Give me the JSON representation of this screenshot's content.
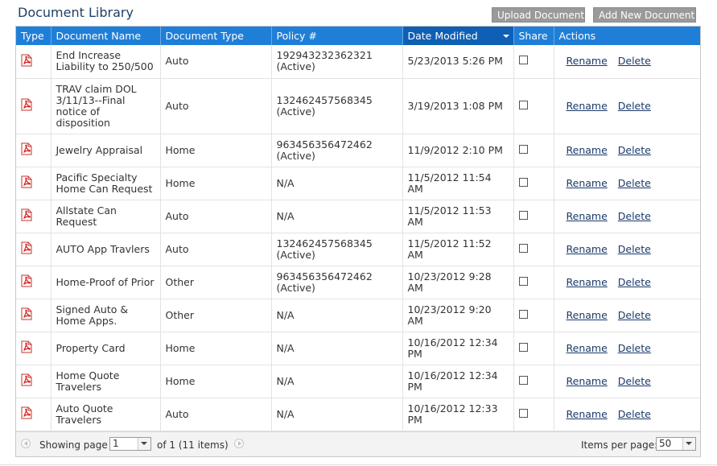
{
  "page_title": "Document Library",
  "buttons": {
    "upload": "Upload Document",
    "add_new": "Add New Document"
  },
  "columns": {
    "type": "Type",
    "name": "Document Name",
    "doctype": "Document Type",
    "policy": "Policy #",
    "date": "Date Modified",
    "share": "Share",
    "actions": "Actions"
  },
  "actions": {
    "rename": "Rename",
    "delete": "Delete"
  },
  "rows": [
    {
      "name": "End Increase Liability to 250/500",
      "doctype": "Auto",
      "policy": "192943232362321 (Active)",
      "date": "5/23/2013 5:26 PM",
      "shared": false
    },
    {
      "name": "TRAV claim DOL 3/11/13--Final notice of disposition",
      "doctype": "Auto",
      "policy": "132462457568345 (Active)",
      "date": "3/19/2013 1:08 PM",
      "shared": false
    },
    {
      "name": "Jewelry Appraisal",
      "doctype": "Home",
      "policy": "963456356472462 (Active)",
      "date": "11/9/2012 2:10 PM",
      "shared": false
    },
    {
      "name": "Pacific Specialty Home Can Request",
      "doctype": "Home",
      "policy": "N/A",
      "date": "11/5/2012 11:54 AM",
      "shared": false
    },
    {
      "name": "Allstate Can Request",
      "doctype": "Auto",
      "policy": "N/A",
      "date": "11/5/2012 11:53 AM",
      "shared": false
    },
    {
      "name": "AUTO App Travlers",
      "doctype": "Auto",
      "policy": "132462457568345 (Active)",
      "date": "11/5/2012 11:52 AM",
      "shared": false
    },
    {
      "name": "Home-Proof of Prior",
      "doctype": "Other",
      "policy": "963456356472462 (Active)",
      "date": "10/23/2012 9:28 AM",
      "shared": false
    },
    {
      "name": "Signed Auto & Home Apps.",
      "doctype": "Other",
      "policy": "N/A",
      "date": "10/23/2012 9:20 AM",
      "shared": false
    },
    {
      "name": "Property Card",
      "doctype": "Home",
      "policy": "N/A",
      "date": "10/16/2012 12:34 PM",
      "shared": false
    },
    {
      "name": "Home Quote Travelers",
      "doctype": "Home",
      "policy": "N/A",
      "date": "10/16/2012 12:34 PM",
      "shared": false
    },
    {
      "name": "Auto Quote Travelers",
      "doctype": "Auto",
      "policy": "N/A",
      "date": "10/16/2012 12:33 PM",
      "shared": false
    }
  ],
  "pager": {
    "showing_label": "Showing page",
    "page": "1",
    "of_text": "of 1 (11 items)",
    "items_per_page_label": "Items per page:",
    "items_per_page": "50"
  },
  "icons": {
    "file_type": "pdf-icon",
    "sort": "sort-descending-icon",
    "prev": "arrow-left-icon",
    "next": "arrow-right-icon"
  },
  "colors": {
    "header_bg": "#1f7fd8",
    "header_sorted_bg": "#0f5fb4",
    "title": "#1f3f66",
    "button_bg": "#9a9a9a",
    "pdf_red": "#d0201a",
    "link": "#1a3a6a"
  }
}
